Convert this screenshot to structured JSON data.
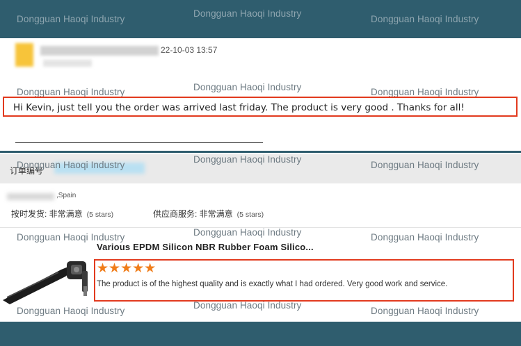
{
  "watermark": "Dongguan Haoqi Industry",
  "message": {
    "date": "22-10-03 13:57",
    "text": "Hi Kevin, just tell you the order was arrived last friday. The product is very good . Thanks for all!"
  },
  "order": {
    "label": "订单编号",
    "location": ",Spain",
    "delivery_label": "按时发货: 非常满意",
    "delivery_stars": "(5 stars)",
    "service_label": "供应商服务: 非常满意",
    "service_stars": "(5 stars)"
  },
  "product": {
    "title": "Various EPDM Silicon NBR Rubber Foam Silico...",
    "stars": "★★★★★",
    "rating": 5,
    "review": "The product is of the highest quality and is exactly what I had ordered. Very good work and service."
  },
  "colors": {
    "band": "#2f5d6e",
    "highlight": "#e23a1e",
    "star": "#f07d1a"
  }
}
